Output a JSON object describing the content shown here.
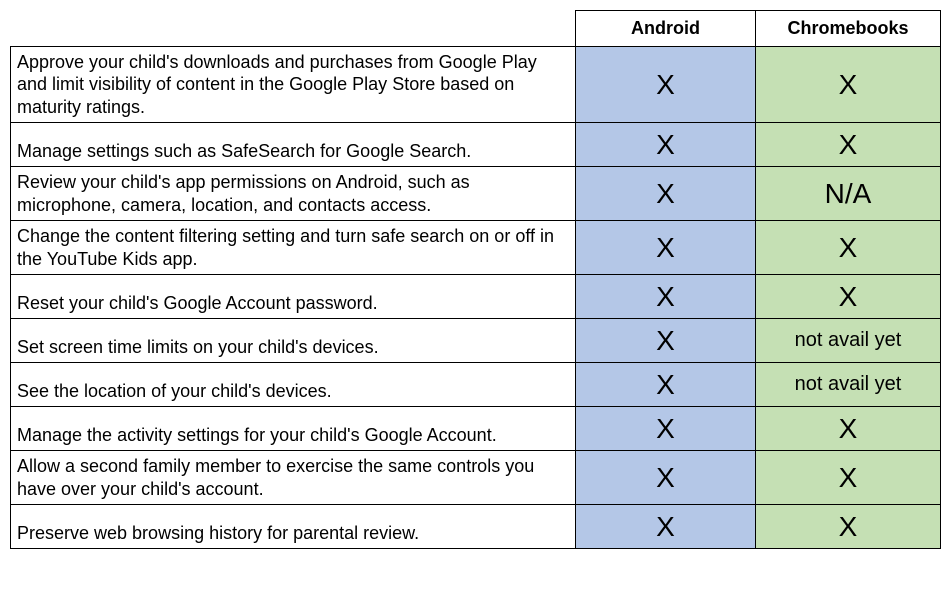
{
  "headers": {
    "android": "Android",
    "chromebooks": "Chromebooks"
  },
  "rows": [
    {
      "desc": "Approve your child's downloads and purchases from Google Play and limit visibility of content in the Google Play Store based on maturity ratings.",
      "android": "X",
      "chromebooks": "X"
    },
    {
      "desc": "Manage settings such as SafeSearch for Google Search.",
      "android": "X",
      "chromebooks": "X"
    },
    {
      "desc": "Review your child's app permissions on Android, such as microphone, camera, location, and contacts access.",
      "android": "X",
      "chromebooks": "N/A"
    },
    {
      "desc": "Change the content filtering setting and turn safe search on or off in the YouTube Kids app.",
      "android": "X",
      "chromebooks": "X"
    },
    {
      "desc": "Reset your child's Google Account password.",
      "android": "X",
      "chromebooks": "X"
    },
    {
      "desc": "Set screen time limits on your child's devices.",
      "android": "X",
      "chromebooks": "not avail yet"
    },
    {
      "desc": "See the location of your child's devices.",
      "android": "X",
      "chromebooks": "not avail yet"
    },
    {
      "desc": "Manage the activity settings for your child's Google Account.",
      "android": "X",
      "chromebooks": "X"
    },
    {
      "desc": "Allow a second family member to exercise the same controls you have over your child's account.",
      "android": "X",
      "chromebooks": "X"
    },
    {
      "desc": "Preserve web browsing history for parental review.",
      "android": "X",
      "chromebooks": "X"
    }
  ]
}
